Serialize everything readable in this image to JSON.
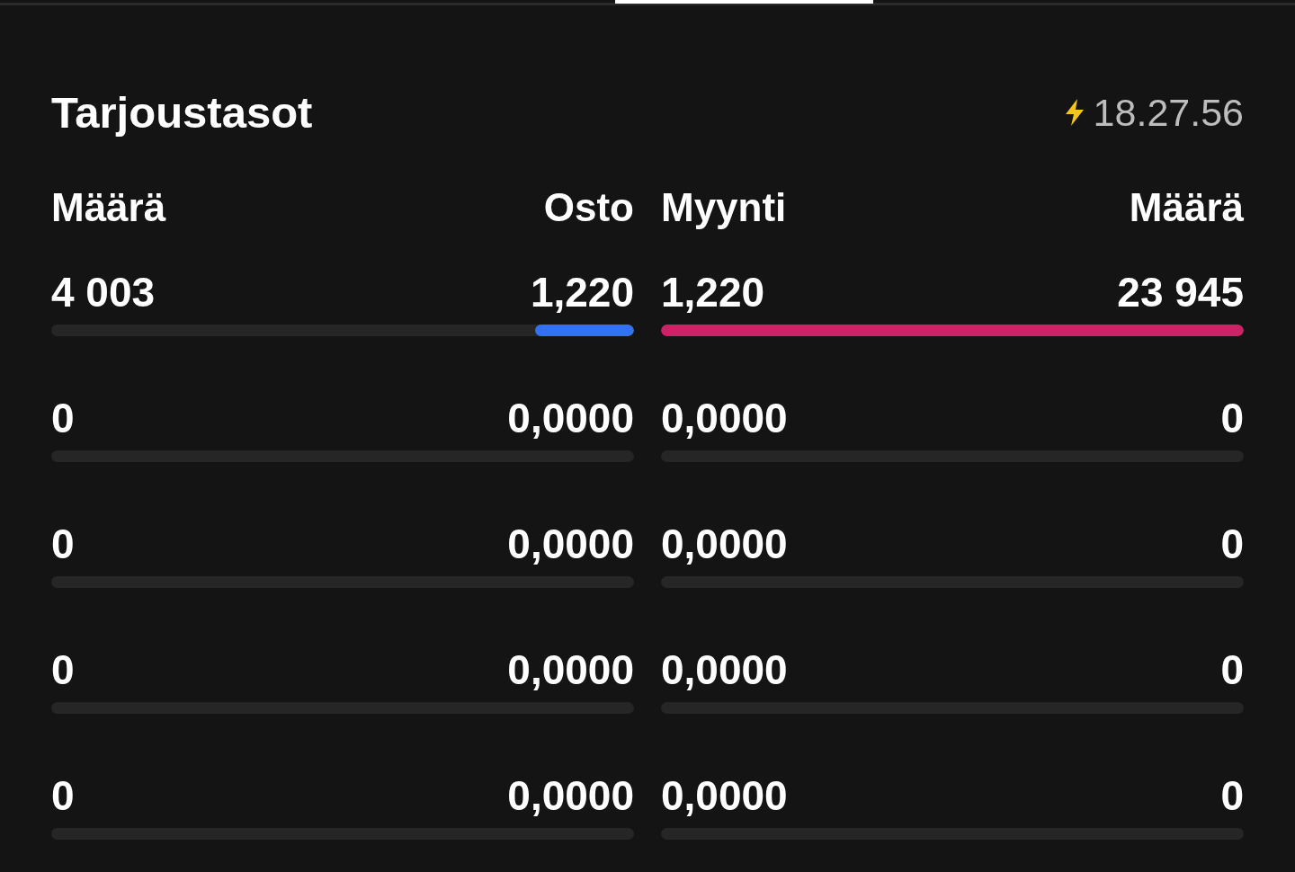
{
  "title": "Tarjoustasot",
  "updated_time": "18.27.56",
  "columns": [
    "Määrä",
    "Osto",
    "Myynti",
    "Määrä"
  ],
  "levels": [
    {
      "bid": {
        "quantity": "4 003",
        "price": "1,220",
        "level": 0.17
      },
      "ask": {
        "price": "1,220",
        "quantity": "23 945",
        "level": 1
      }
    },
    {
      "bid": {
        "quantity": "0",
        "price": "0,0000"
      },
      "ask": {
        "price": "0,0000",
        "quantity": "0"
      }
    },
    {
      "bid": {
        "quantity": "0",
        "price": "0,0000"
      },
      "ask": {
        "price": "0,0000",
        "quantity": "0"
      }
    },
    {
      "bid": {
        "quantity": "0",
        "price": "0,0000"
      },
      "ask": {
        "price": "0,0000",
        "quantity": "0"
      }
    },
    {
      "bid": {
        "quantity": "0",
        "price": "0,0000"
      },
      "ask": {
        "price": "0,0000",
        "quantity": "0"
      }
    }
  ]
}
